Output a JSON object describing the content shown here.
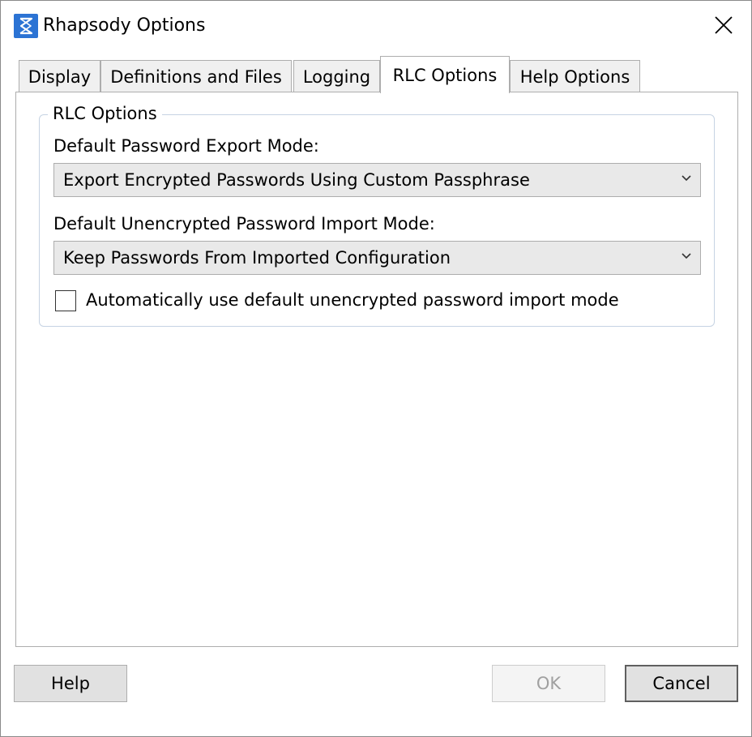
{
  "window": {
    "title": "Rhapsody Options",
    "icon": "rhapsody-app-icon",
    "close_icon": "close-icon"
  },
  "tabs": [
    {
      "label": "Display",
      "active": false
    },
    {
      "label": "Definitions and Files",
      "active": false
    },
    {
      "label": "Logging",
      "active": false
    },
    {
      "label": "RLC Options",
      "active": true
    },
    {
      "label": "Help Options",
      "active": false
    }
  ],
  "rlc": {
    "group_title": "RLC Options",
    "export_mode_label": "Default Password Export Mode:",
    "export_mode_value": "Export Encrypted Passwords Using Custom Passphrase",
    "import_mode_label": "Default Unencrypted Password Import Mode:",
    "import_mode_value": "Keep Passwords From Imported Configuration",
    "auto_checkbox_label": "Automatically use default unencrypted password import mode",
    "auto_checkbox_checked": false
  },
  "buttons": {
    "help": "Help",
    "ok": "OK",
    "cancel": "Cancel"
  },
  "colors": {
    "app_icon": "#2b73d4",
    "button_face": "#e1e1e1",
    "disabled_text": "#a0a0a0"
  }
}
